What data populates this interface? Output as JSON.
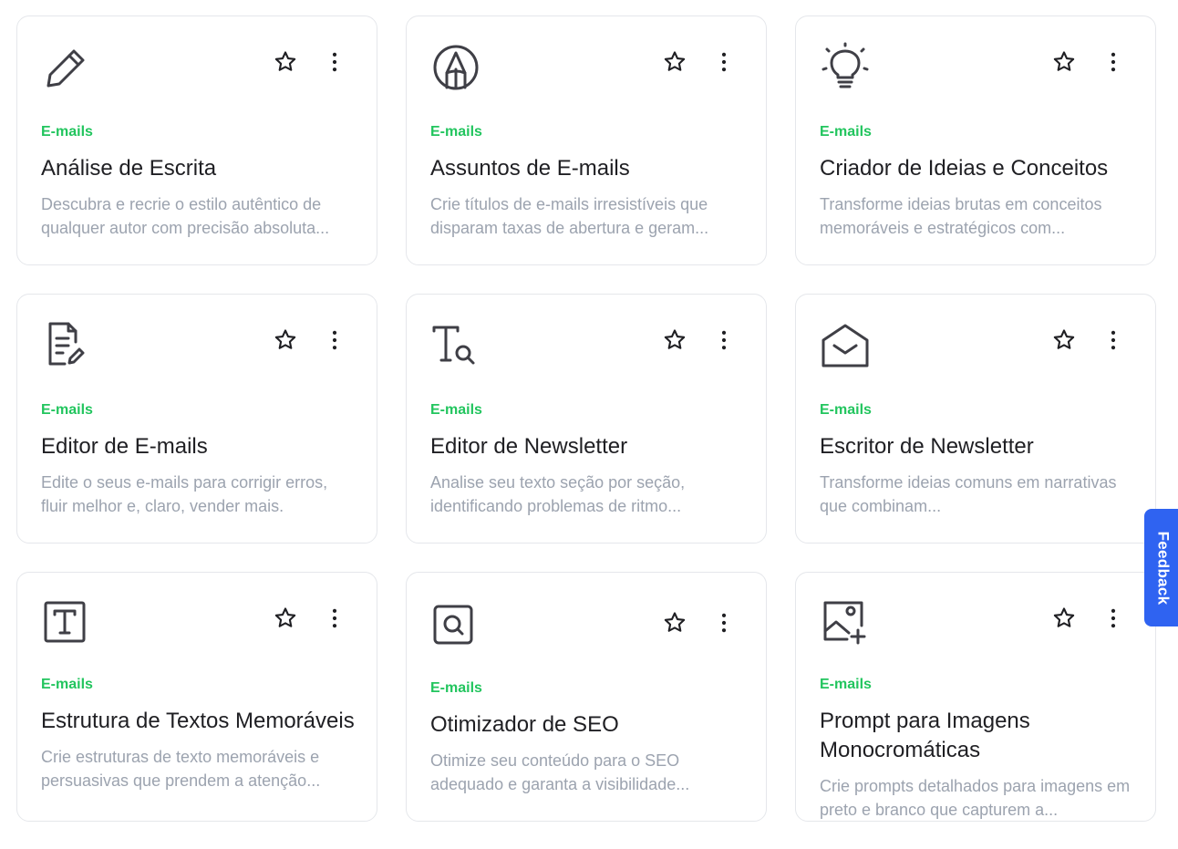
{
  "cards": [
    {
      "icon": "pencil-icon",
      "category": "E-mails",
      "title": "Análise de Escrita",
      "description": "Descubra e recrie o estilo autêntico de qualquer autor com precisão absoluta..."
    },
    {
      "icon": "pencil-tip-circle-icon",
      "category": "E-mails",
      "title": "Assuntos de E-mails",
      "description": "Crie títulos de e-mails irresistíveis que disparam taxas de abertura e geram..."
    },
    {
      "icon": "lightbulb-icon",
      "category": "E-mails",
      "title": "Criador de Ideias e Conceitos",
      "description": "Transforme ideias brutas em conceitos memoráveis e estratégicos com..."
    },
    {
      "icon": "document-edit-icon",
      "category": "E-mails",
      "title": "Editor de E-mails",
      "description": "Edite o seus e-mails para corrigir erros, fluir melhor e, claro, vender mais."
    },
    {
      "icon": "text-search-icon",
      "category": "E-mails",
      "title": "Editor de Newsletter",
      "description": "Analise seu texto seção por seção, identificando problemas de ritmo..."
    },
    {
      "icon": "open-envelope-icon",
      "category": "E-mails",
      "title": "Escritor de Newsletter",
      "description": "Transforme ideias comuns em narrativas que combinam..."
    },
    {
      "icon": "text-box-icon",
      "category": "E-mails",
      "title": "Estrutura de Textos Memoráveis",
      "description": "Crie estruturas de texto memoráveis e persuasivas que prendem a atenção..."
    },
    {
      "icon": "search-box-icon",
      "category": "E-mails",
      "title": "Otimizador de SEO",
      "description": "Otimize seu conteúdo para o SEO adequado e garanta a visibilidade..."
    },
    {
      "icon": "image-add-icon",
      "category": "E-mails",
      "title": "Prompt para Imagens Monocromáticas",
      "description": "Crie prompts detalhados para imagens em preto e branco que capturem a..."
    }
  ],
  "feedback": {
    "label": "Feedback",
    "color": "#2f63f1"
  },
  "colors": {
    "category": "#22c55e",
    "title": "#1f1f23",
    "description": "#9ca3af",
    "border": "#e5e7eb"
  }
}
